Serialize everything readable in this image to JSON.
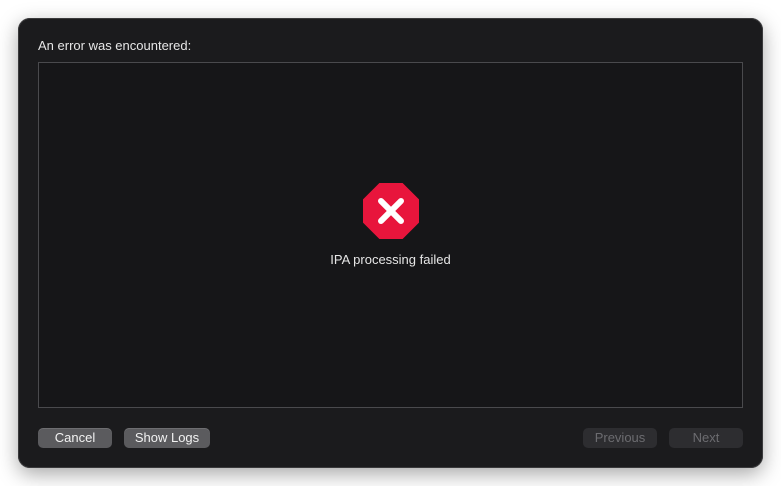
{
  "dialog": {
    "heading": "An error was encountered:",
    "error_message": "IPA processing failed",
    "icon": "error-x-octagon-icon"
  },
  "buttons": {
    "cancel": "Cancel",
    "show_logs": "Show Logs",
    "previous": "Previous",
    "next": "Next"
  },
  "colors": {
    "window_bg": "#1b1b1d",
    "error_icon": "#e8153c",
    "button_active": "#5b5b5e",
    "button_disabled": "#2d2d30"
  }
}
